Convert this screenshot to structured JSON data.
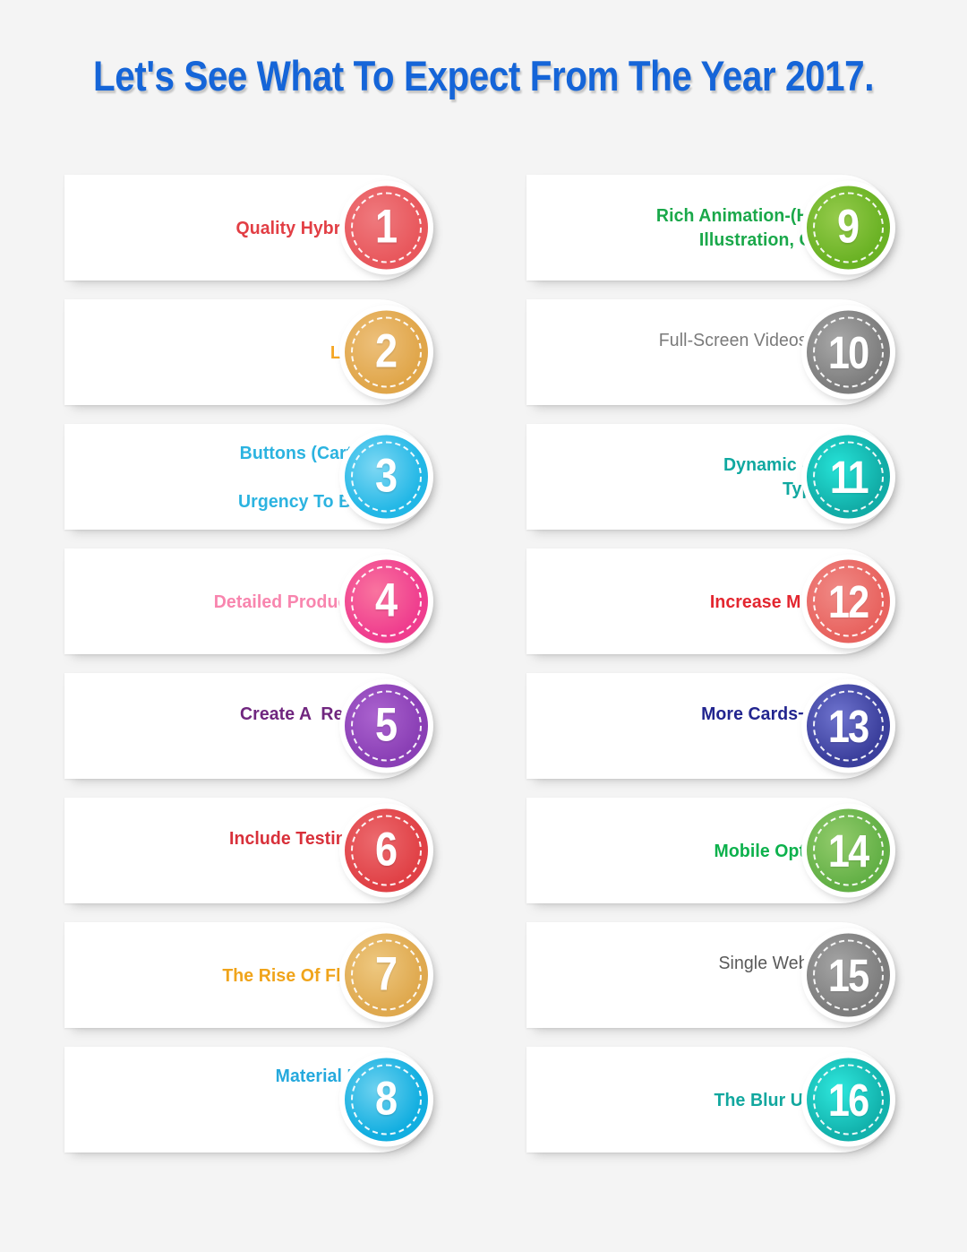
{
  "page": {
    "title": "Let's See What To Expect From The Year 2017.",
    "title_color": "#1565d8",
    "background_color": "#f4f4f4"
  },
  "columns": {
    "left": [
      {
        "number": "1",
        "label": "Quality Hybrid Design",
        "text_color": "#e23e44",
        "badge_color": "#e8575c",
        "badge_color_light": "#ef7a7e",
        "weight": "bold"
      },
      {
        "number": "2",
        "label": "Large Icon",
        "text_color": "#f5a623",
        "badge_color": "#e0a64a",
        "badge_color_light": "#edc07b",
        "weight": "bold"
      },
      {
        "number": "3",
        "label": "Buttons (Cart Button- Creates\nUrgency To Buy Now)",
        "text_color": "#2bb3e0",
        "badge_color": "#22b7e6",
        "badge_color_light": "#7fd8f4",
        "weight": "bold"
      },
      {
        "number": "4",
        "label": "Detailed Product Review",
        "text_color": "#f885ae",
        "badge_color": "#ef3d8e",
        "badge_color_light": "#f9749f",
        "weight": "bold"
      },
      {
        "number": "5",
        "label": "Create A  Responsive Website",
        "text_color": "#70267f",
        "badge_color": "#8a3fb5",
        "badge_color_light": "#ab63cf",
        "weight": "bold"
      },
      {
        "number": "6",
        "label": "Include Testimonials & Review",
        "text_color": "#d8303a",
        "badge_color": "#e04146",
        "badge_color_light": "#ec6a6e",
        "weight": "bold"
      },
      {
        "number": "7",
        "label": "The Rise Of Flat Design",
        "text_color": "#f0a41b",
        "badge_color": "#dfa94f",
        "badge_color_light": "#eec880",
        "weight": "bold"
      },
      {
        "number": "8",
        "label": "Material Design's Influence\nGrows",
        "text_color": "#25a9dd",
        "badge_color": "#12aee0",
        "badge_color_light": "#6ed2f0",
        "weight": "bold"
      }
    ],
    "right": [
      {
        "number": "9",
        "label": "Rich Animation-(Hd Visual,\nIllustration, Graphics)",
        "text_color": "#1aa84a",
        "badge_color": "#6ab224",
        "badge_color_light": "#95cb4c",
        "weight": "bold"
      },
      {
        "number": "10",
        "label": "Full-Screen Videos Or Back-\ngrounds",
        "text_color": "#7a7a7a",
        "badge_color": "#7d7d7d",
        "badge_color_light": "#a9a9a9",
        "weight": "thin"
      },
      {
        "number": "11",
        "label": "Dynamic & Correct\nTypography",
        "text_color": "#0fa8a0",
        "badge_color": "#11aca6",
        "badge_color_light": "#26e3d8",
        "weight": "bold"
      },
      {
        "number": "12",
        "label": "Increase Minimalism",
        "text_color": "#e3262f",
        "badge_color": "#e8635f",
        "badge_color_light": "#f08a86",
        "weight": "bold"
      },
      {
        "number": "13",
        "label": "More Cards−Interface Design",
        "text_color": "#22258f",
        "badge_color": "#3b3f9c",
        "badge_color_light": "#6f74cf",
        "weight": "bold"
      },
      {
        "number": "14",
        "label": "Mobile Optimization",
        "text_color": "#0cb14c",
        "badge_color": "#63b046",
        "badge_color_light": "#93cc6c",
        "weight": "bold"
      },
      {
        "number": "15",
        "label": "Single Website Page Bonanza",
        "text_color": "#595959",
        "badge_color": "#7d7d7d",
        "badge_color_light": "#a5a5a5",
        "weight": "thin"
      },
      {
        "number": "16",
        "label": "The Blur Up Method",
        "text_color": "#11a79e",
        "badge_color": "#12b2ac",
        "badge_color_light": "#2fe8de",
        "weight": "bold"
      }
    ]
  }
}
